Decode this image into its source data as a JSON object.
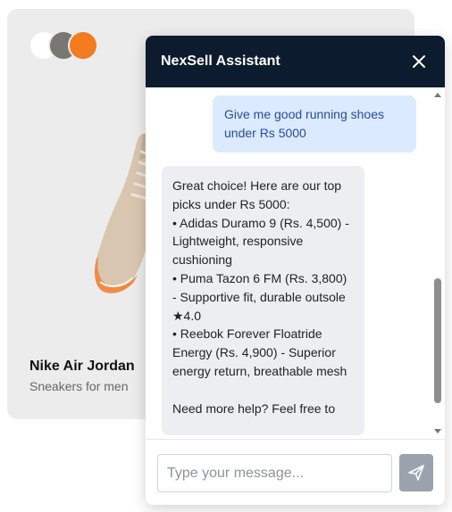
{
  "product": {
    "name": "Nike Air Jordan",
    "subtitle": "Sneakers for men",
    "swatches": [
      {
        "name": "white",
        "color": "#ffffff"
      },
      {
        "name": "gray",
        "color": "#7a7672"
      },
      {
        "name": "orange",
        "color": "#f47b20"
      }
    ]
  },
  "chat": {
    "title": "NexSell Assistant",
    "messages": [
      {
        "role": "user",
        "text": "Give me good running shoes under Rs 5000"
      },
      {
        "role": "assistant",
        "text": "Great choice! Here are our top picks under Rs 5000:\n• Adidas Duramo 9 (Rs. 4,500) - Lightweight, responsive cushioning\n• Puma Tazon 6 FM (Rs. 3,800) - Supportive fit, durable outsole ★4.0\n• Reebok Forever Floatride Energy (Rs. 4,900) - Superior energy return, breathable mesh\n\nNeed more help? Feel free to"
      }
    ],
    "input_placeholder": "Type your message...",
    "input_value": ""
  },
  "colors": {
    "header_bg": "#0d1b2e",
    "user_bubble": "#dbeafe",
    "bot_bubble": "#eceef1",
    "card_bg": "#ececec"
  },
  "icons": {
    "close": "close-icon",
    "send": "send-icon"
  }
}
